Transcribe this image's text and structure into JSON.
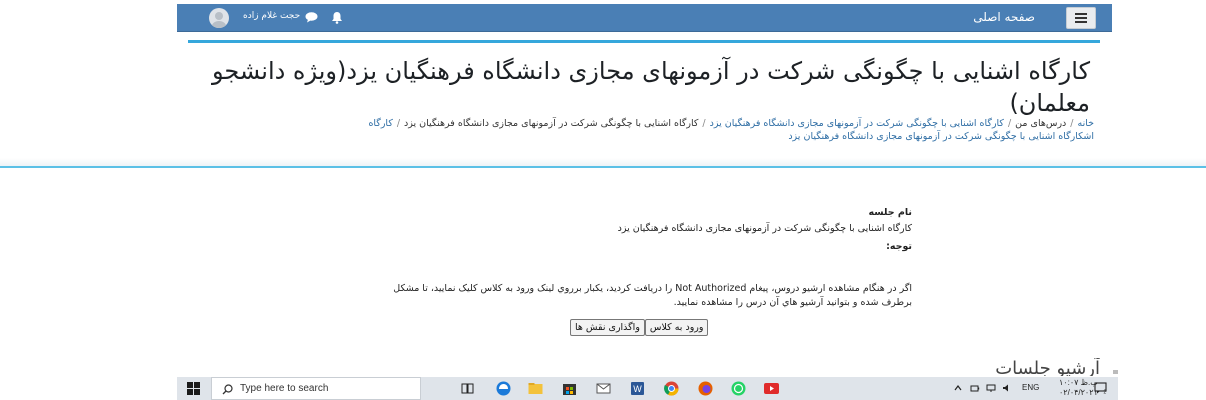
{
  "navbar": {
    "home_label": "صفحه اصلی",
    "user_name": "حجت غلام زاده"
  },
  "header": {
    "title": "کارگاه اشنایی با چگونگی شرکت در آزمونهای مجازی دانشگاه فرهنگیان یزد(ویژه دانشجو معلمان)",
    "breadcrumb": [
      "خانه",
      "درس‌های من",
      "کارگاه اشنایی با چگونگی شرکت در آزمونهای مجازی دانشگاه فرهنگیان یزد",
      "کارگاه اشنایی با چگونگی شرکت در آزمونهای مجازی دانشگاه فرهنگیان یزد",
      "کارگاه اشکارگاه اشنایی با چگونگی شرکت در آزمونهای مجازی دانشگاه فرهنگیان یزد"
    ]
  },
  "session": {
    "name_label": "نام جلسه",
    "name_value": "کارگاه اشنایی با چگونگی شرکت در آزمونهای مجازی دانشگاه فرهنگیان یزد",
    "note_label": "توجه:",
    "note_text": "اگر در هنگام مشاهده ارشیو دروس، پیغام Not Authorized را دریافت کردید، یکبار برروي لینک ورود به کلاس کلیک نمایید، تا مشکل برطرف شده و بتوانید آرشیو هاي آن درس را مشاهده نمایید.",
    "enter_button": "ورود به کلاس",
    "assign_button": "واگذاری نقش ها",
    "archive_heading": "آرشیو جلسات"
  },
  "taskbar": {
    "search_placeholder": "Type here to search",
    "lang": "ENG",
    "time": "ب.ظ ۱۰:۰۷",
    "date": "۰۲/۰۴/۲۰۲۱"
  },
  "colors": {
    "navbar": "#4a7fb5",
    "accent_line": "#35a7dc",
    "link": "#2e6da4"
  }
}
